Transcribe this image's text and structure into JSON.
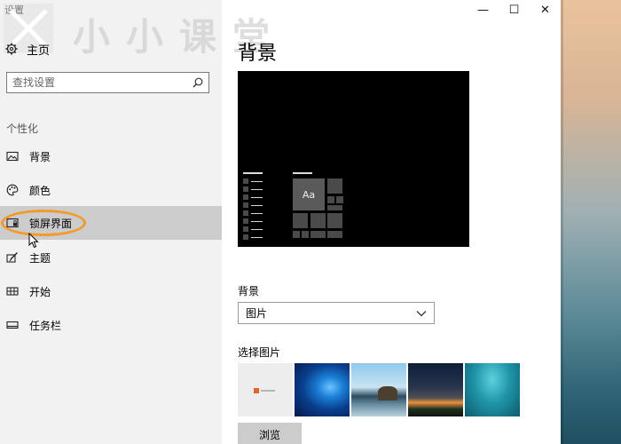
{
  "window": {
    "title": "设置",
    "watermark": "小小课堂"
  },
  "caption_buttons": {
    "minimize": "—",
    "maximize": "☐",
    "close": "✕"
  },
  "sidebar": {
    "home_label": "主页",
    "search_placeholder": "查找设置",
    "group_label": "个性化",
    "items": [
      {
        "label": "背景",
        "icon": "picture-icon"
      },
      {
        "label": "颜色",
        "icon": "palette-icon"
      },
      {
        "label": "锁屏界面",
        "icon": "lock-screen-icon",
        "active": true
      },
      {
        "label": "主题",
        "icon": "brush-icon"
      },
      {
        "label": "开始",
        "icon": "start-grid-icon"
      },
      {
        "label": "任务栏",
        "icon": "taskbar-icon"
      }
    ]
  },
  "main": {
    "title": "背景",
    "preview_tile_text": "Aa",
    "background_label": "背景",
    "background_value": "图片",
    "choose_label": "选择图片",
    "browse_label": "浏览"
  },
  "colors": {
    "accent_highlight": "#f39a2c",
    "active_item_bg": "#cccccc",
    "sidebar_bg": "#f2f2f2"
  }
}
